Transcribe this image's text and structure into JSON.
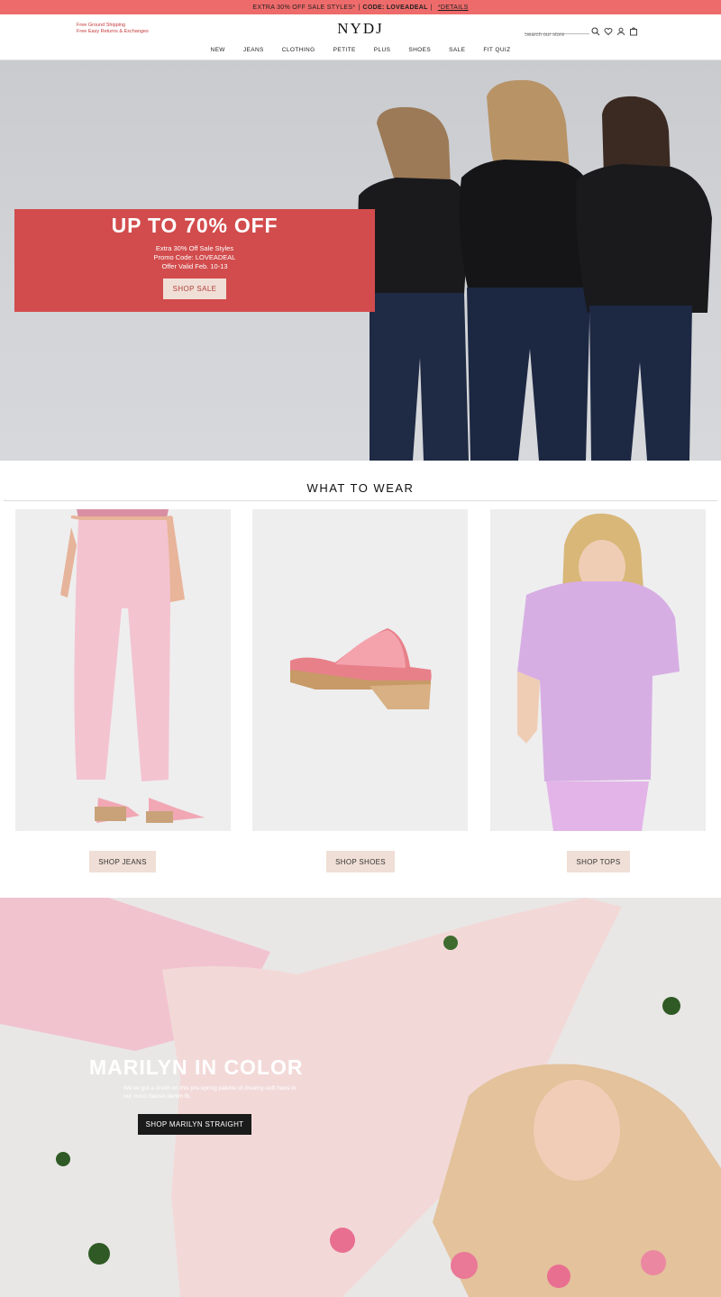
{
  "promo_bar": {
    "text": "EXTRA 30% OFF SALE STYLES*",
    "separator": "|",
    "code": "CODE: LOVEADEAL",
    "separator2": "|",
    "details": "*DETAILS"
  },
  "header": {
    "shipping_line1": "Free Ground Shipping",
    "shipping_line2": "Free Easy Returns & Exchanges",
    "logo": "NYDJ",
    "search_placeholder": "Search our store",
    "nav": [
      "NEW",
      "JEANS",
      "CLOTHING",
      "PETITE",
      "PLUS",
      "SHOES",
      "SALE",
      "FIT QUIZ"
    ]
  },
  "hero": {
    "headline": "UP TO 70% OFF",
    "line1": "Extra 30% Off Sale Styles",
    "line2": "Promo Code: LOVEADEAL",
    "line3": "Offer Valid Feb. 10-13",
    "cta": "SHOP SALE"
  },
  "what_to_wear": {
    "title": "WHAT TO WEAR",
    "cards": [
      {
        "cta": "SHOP JEANS"
      },
      {
        "cta": "SHOP SHOES"
      },
      {
        "cta": "SHOP TOPS"
      }
    ]
  },
  "feature": {
    "headline": "MARILYN IN COLOR",
    "subtext": "We've got a crush on this pre-spring palette of dreamy-soft hues in our most classic denim fit.",
    "cta": "SHOP MARILYN STRAIGHT"
  },
  "colors": {
    "promo_bar": "#ee6b6b",
    "hero_promo_box": "#d24c4d",
    "cta_beige": "#f0dfd6",
    "feature_cta": "#1b1b1b"
  }
}
